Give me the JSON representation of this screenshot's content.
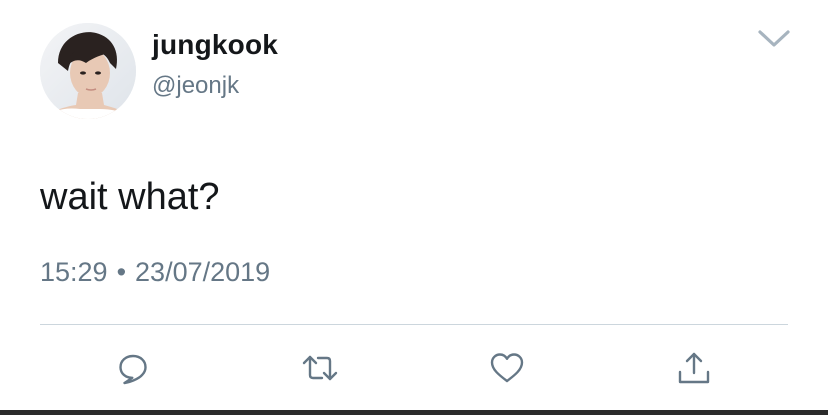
{
  "tweet": {
    "author": {
      "display_name": "jungkook",
      "handle": "@jeonjk"
    },
    "text": "wait what?",
    "time": "15:29",
    "separator": "•",
    "date": "23/07/2019"
  },
  "actions": {
    "reply_icon": "speech-bubble-icon",
    "retweet_icon": "retweet-icon",
    "like_icon": "heart-icon",
    "share_icon": "share-upload-icon"
  },
  "colors": {
    "primary_text": "#14171a",
    "secondary_text": "#657786",
    "divider": "#ccd6dd"
  }
}
